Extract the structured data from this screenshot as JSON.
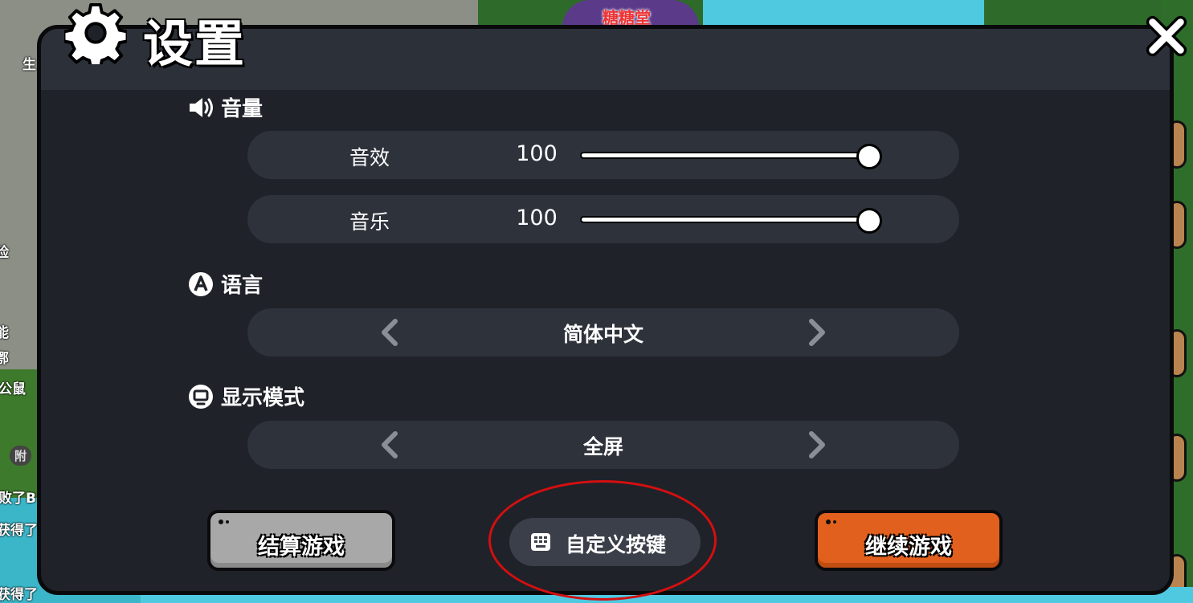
{
  "background": {
    "shop_label": "糖糖堂",
    "hud_left": [
      "生",
      "险",
      "能",
      "鄂",
      "公鼠",
      "败了B",
      "获得了",
      "获得了"
    ],
    "hud_pills": [
      "附"
    ]
  },
  "dialog": {
    "title": "设置",
    "icons": {
      "title": "gear-icon",
      "close": "close-icon"
    }
  },
  "volume": {
    "heading": "音量",
    "icon": "speaker-icon",
    "rows": [
      {
        "label": "音效",
        "value": "100",
        "level": 1.0
      },
      {
        "label": "音乐",
        "value": "100",
        "level": 1.0
      }
    ]
  },
  "language": {
    "heading": "语言",
    "icon": "language-icon",
    "selected": "简体中文"
  },
  "display": {
    "heading": "显示模式",
    "icon": "monitor-icon",
    "selected": "全屏"
  },
  "buttons": {
    "settle": "结算游戏",
    "custom_keys": "自定义按键",
    "continue": "继续游戏"
  },
  "colors": {
    "panel": "#1f2229",
    "header": "#2c3039",
    "row": "#2e323b",
    "continue_button": "#e2601d",
    "settle_button": "#a8a8a8",
    "highlight": "#d40f10"
  }
}
